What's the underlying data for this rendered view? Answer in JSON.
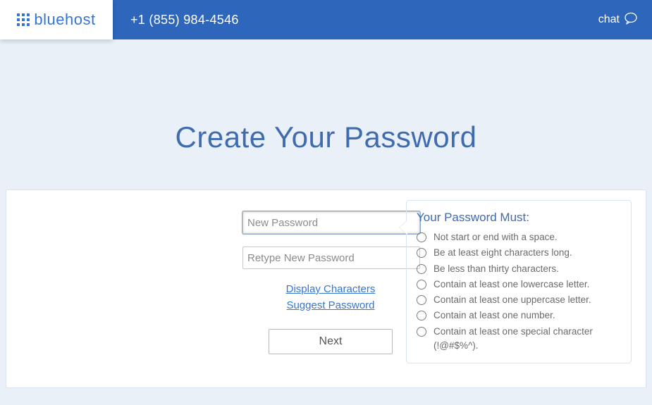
{
  "header": {
    "brand": "bluehost",
    "phone": "+1 (855) 984-4546",
    "chat_label": "chat"
  },
  "hero": {
    "title": "Create Your Password"
  },
  "form": {
    "new_password_placeholder": "New Password",
    "retype_password_placeholder": "Retype New Password",
    "display_characters": "Display Characters",
    "suggest_password": "Suggest Password",
    "next_label": "Next"
  },
  "rules": {
    "title": "Your Password Must:",
    "items": [
      "Not start or end with a space.",
      "Be at least eight characters long.",
      "Be less than thirty characters.",
      "Contain at least one lowercase letter.",
      "Contain at least one uppercase letter.",
      "Contain at least one number.",
      "Contain at least one special character (!@#$%^)."
    ]
  },
  "colors": {
    "brand_blue": "#3575d3",
    "header_blue": "#2e66bc",
    "page_bg": "#eaf0f8"
  }
}
